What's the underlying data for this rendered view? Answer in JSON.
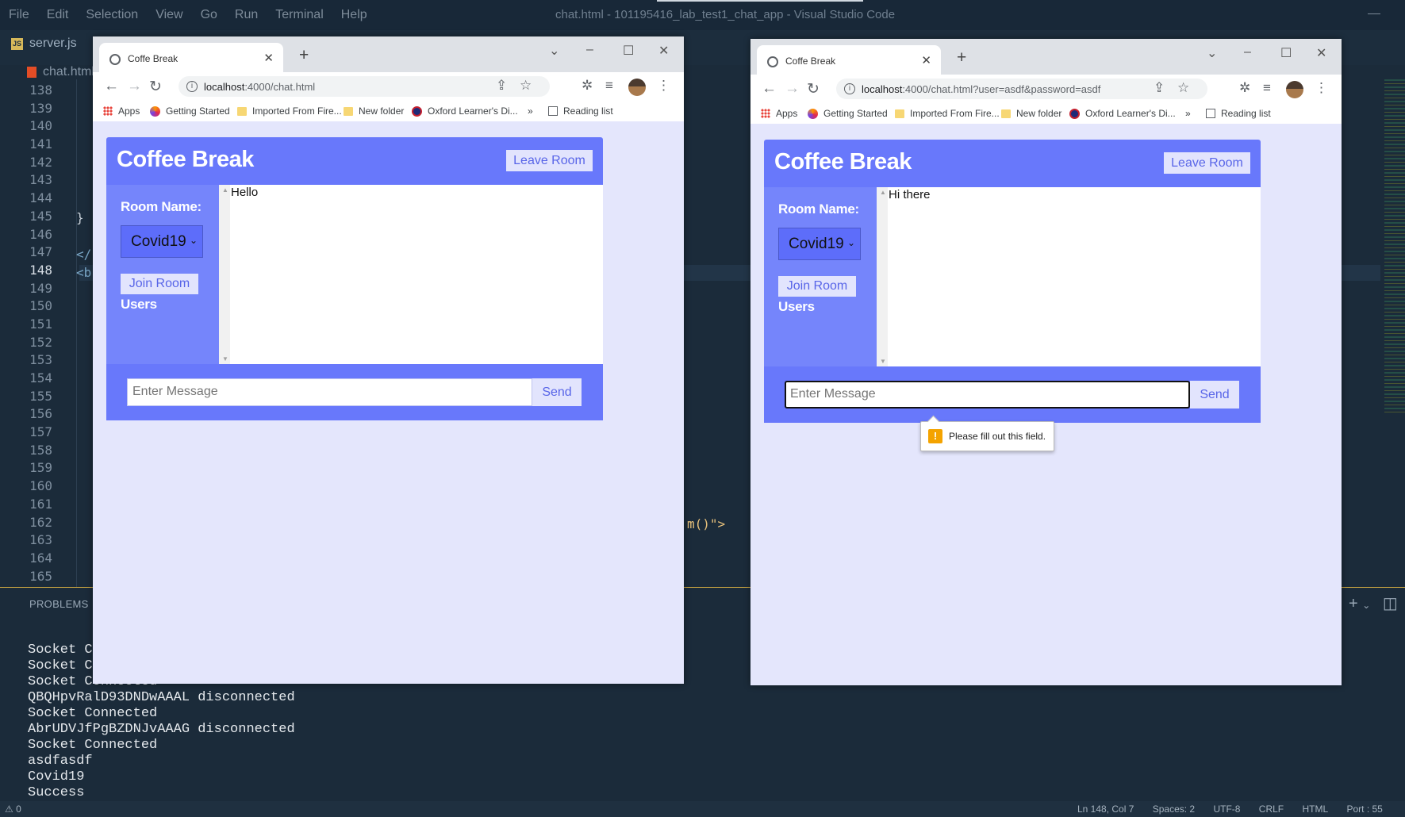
{
  "vscode": {
    "menu": [
      "File",
      "Edit",
      "Selection",
      "View",
      "Go",
      "Run",
      "Terminal",
      "Help"
    ],
    "title": "chat.html - 101195416_lab_test1_chat_app - Visual Studio Code",
    "tab": "server.js",
    "breadcrumb": "chat.html",
    "line_numbers": [
      "138",
      "139",
      "140",
      "141",
      "142",
      "143",
      "144",
      "145",
      "146",
      "147",
      "148",
      "149",
      "150",
      "151",
      "152",
      "153",
      "154",
      "155",
      "156",
      "157",
      "158",
      "159",
      "160",
      "161",
      "162",
      "163",
      "164",
      "165"
    ],
    "code_brace": "}",
    "code_close": "</",
    "code_open": "<b",
    "code_call": "m()\">",
    "panel_tab": "PROBLEMS",
    "terminal_lines": [
      "Socket C",
      "Socket C",
      "Socket Connected",
      "QBQHpvRalD93DNDwAAAL disconnected",
      "Socket Connected",
      "AbrUDVJfPgBZDNJvAAAG disconnected",
      "Socket Connected",
      "asdfasdf",
      "Covid19",
      "Success"
    ],
    "status_left": "⚠ 0",
    "status_right": [
      "Ln 148, Col 7",
      "Spaces: 2",
      "UTF-8",
      "CRLF",
      "HTML",
      "Port : 55"
    ]
  },
  "browser_left": {
    "tab_title": "Coffe Break",
    "url_host": "localhost",
    "url_rest": ":4000/chat.html",
    "bookmarks": [
      "Apps",
      "Getting Started",
      "Imported From Fire...",
      "New folder",
      "Oxford Learner's Di..."
    ],
    "more": "»",
    "reading_list": "Reading list",
    "app": {
      "title": "Coffee Break",
      "leave_label": "Leave Room",
      "room_label": "Room Name:",
      "room_value": "Covid19",
      "join_label": "Join Room",
      "users_label": "Users",
      "message": "Hello",
      "input_placeholder": "Enter Message",
      "send_label": "Send"
    }
  },
  "browser_right": {
    "tab_title": "Coffe Break",
    "url_host": "localhost",
    "url_rest": ":4000/chat.html?user=asdf&password=asdf",
    "bookmarks": [
      "Apps",
      "Getting Started",
      "Imported From Fire...",
      "New folder",
      "Oxford Learner's Di..."
    ],
    "more": "»",
    "reading_list": "Reading list",
    "app": {
      "title": "Coffee Break",
      "leave_label": "Leave Room",
      "room_label": "Room Name:",
      "room_value": "Covid19",
      "join_label": "Join Room",
      "users_label": "Users",
      "message": "Hi there",
      "input_placeholder": "Enter Message",
      "send_label": "Send",
      "validation": "Please fill out this field."
    }
  },
  "colors": {
    "header": "#6878fb",
    "sidebar": "#7585fb",
    "page_bg": "#e4e6fc",
    "button_text": "#5865e8"
  }
}
